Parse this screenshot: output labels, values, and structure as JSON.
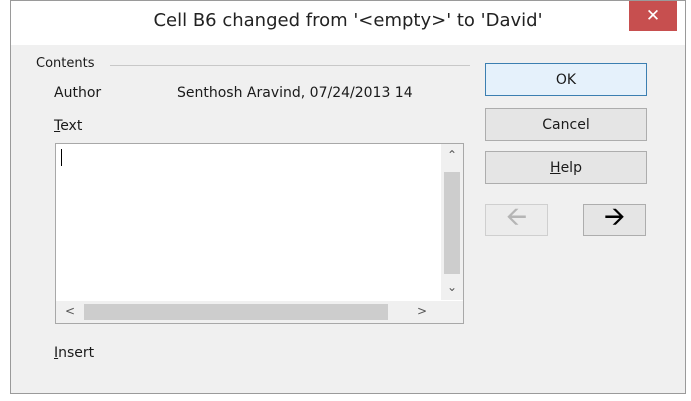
{
  "window": {
    "title": "Cell B6 changed from '<empty>' to 'David'",
    "close_symbol": "✕"
  },
  "contents": {
    "group_label": "Contents",
    "author_label": "Author",
    "author_value": "Senthosh Aravind, 07/24/2013 14",
    "text_label_first": "T",
    "text_label_rest": "ext",
    "text_value": "",
    "insert_label_first": "I",
    "insert_label_rest": "nsert"
  },
  "buttons": {
    "ok_label": "OK",
    "cancel_label": "Cancel",
    "help_label_first": "H",
    "help_label_rest": "elp"
  },
  "navigation": {
    "prev_icon": "left-arrow-icon",
    "next_icon": "right-arrow-icon",
    "prev_enabled": false,
    "next_enabled": true
  },
  "scrollbars": {
    "vertical_up": "⌃",
    "vertical_down": "⌄",
    "horizontal_left": "<",
    "horizontal_right": ">"
  },
  "colors": {
    "close_button": "#c74f4f",
    "default_button_border": "#3c7fb1"
  }
}
